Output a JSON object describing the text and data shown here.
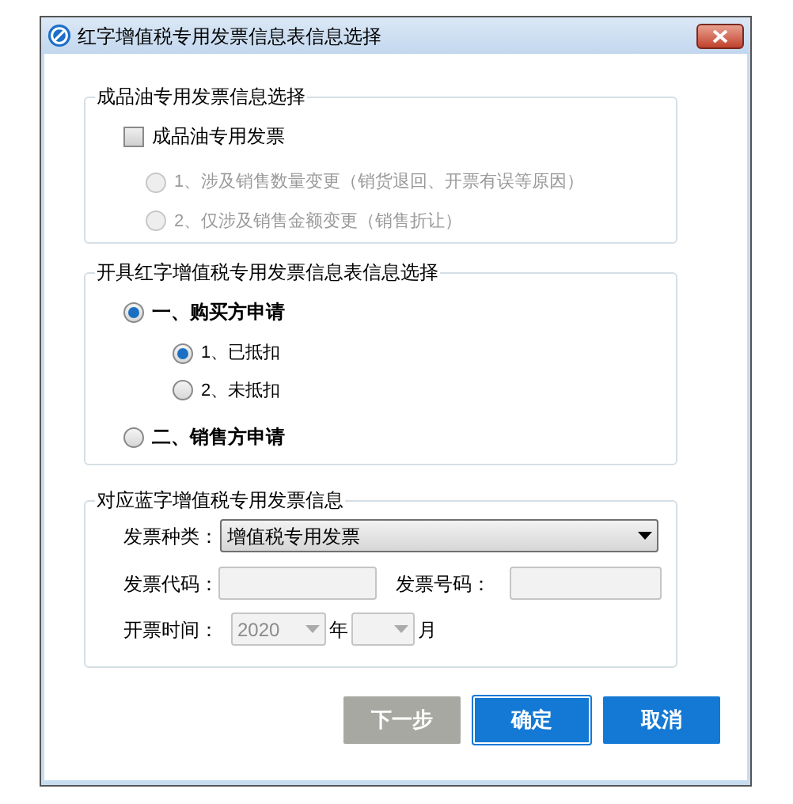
{
  "window": {
    "title": "红字增值税专用发票信息表信息选择"
  },
  "oil_section": {
    "title": "成品油专用发票信息选择",
    "checkbox": {
      "label": "成品油专用发票",
      "checked": false
    },
    "options": [
      {
        "label": "1、涉及销售数量变更（销货退回、开票有误等原因）",
        "selected": false,
        "disabled": true
      },
      {
        "label": "2、仅涉及销售金额变更（销售折让）",
        "selected": false,
        "disabled": true
      }
    ]
  },
  "red_section": {
    "title": "开具红字增值税专用发票信息表信息选择",
    "options": [
      {
        "label": "一、购买方申请",
        "selected": true,
        "children": [
          {
            "label": "1、已抵扣",
            "selected": true
          },
          {
            "label": "2、未抵扣",
            "selected": false
          }
        ]
      },
      {
        "label": "二、销售方申请",
        "selected": false
      }
    ]
  },
  "blue_section": {
    "title": "对应蓝字增值税专用发票信息",
    "invoice_type": {
      "label": "发票种类：",
      "value": "增值税专用发票"
    },
    "invoice_code": {
      "label": "发票代码："
    },
    "invoice_number": {
      "label": "发票号码："
    },
    "issue_time": {
      "label": "开票时间：",
      "year": "2020",
      "year_unit": "年",
      "month_unit": "月"
    }
  },
  "buttons": [
    {
      "label": "下一步",
      "kind": "disabled"
    },
    {
      "label": "确定",
      "kind": "default"
    },
    {
      "label": "取消",
      "kind": "normal"
    }
  ]
}
